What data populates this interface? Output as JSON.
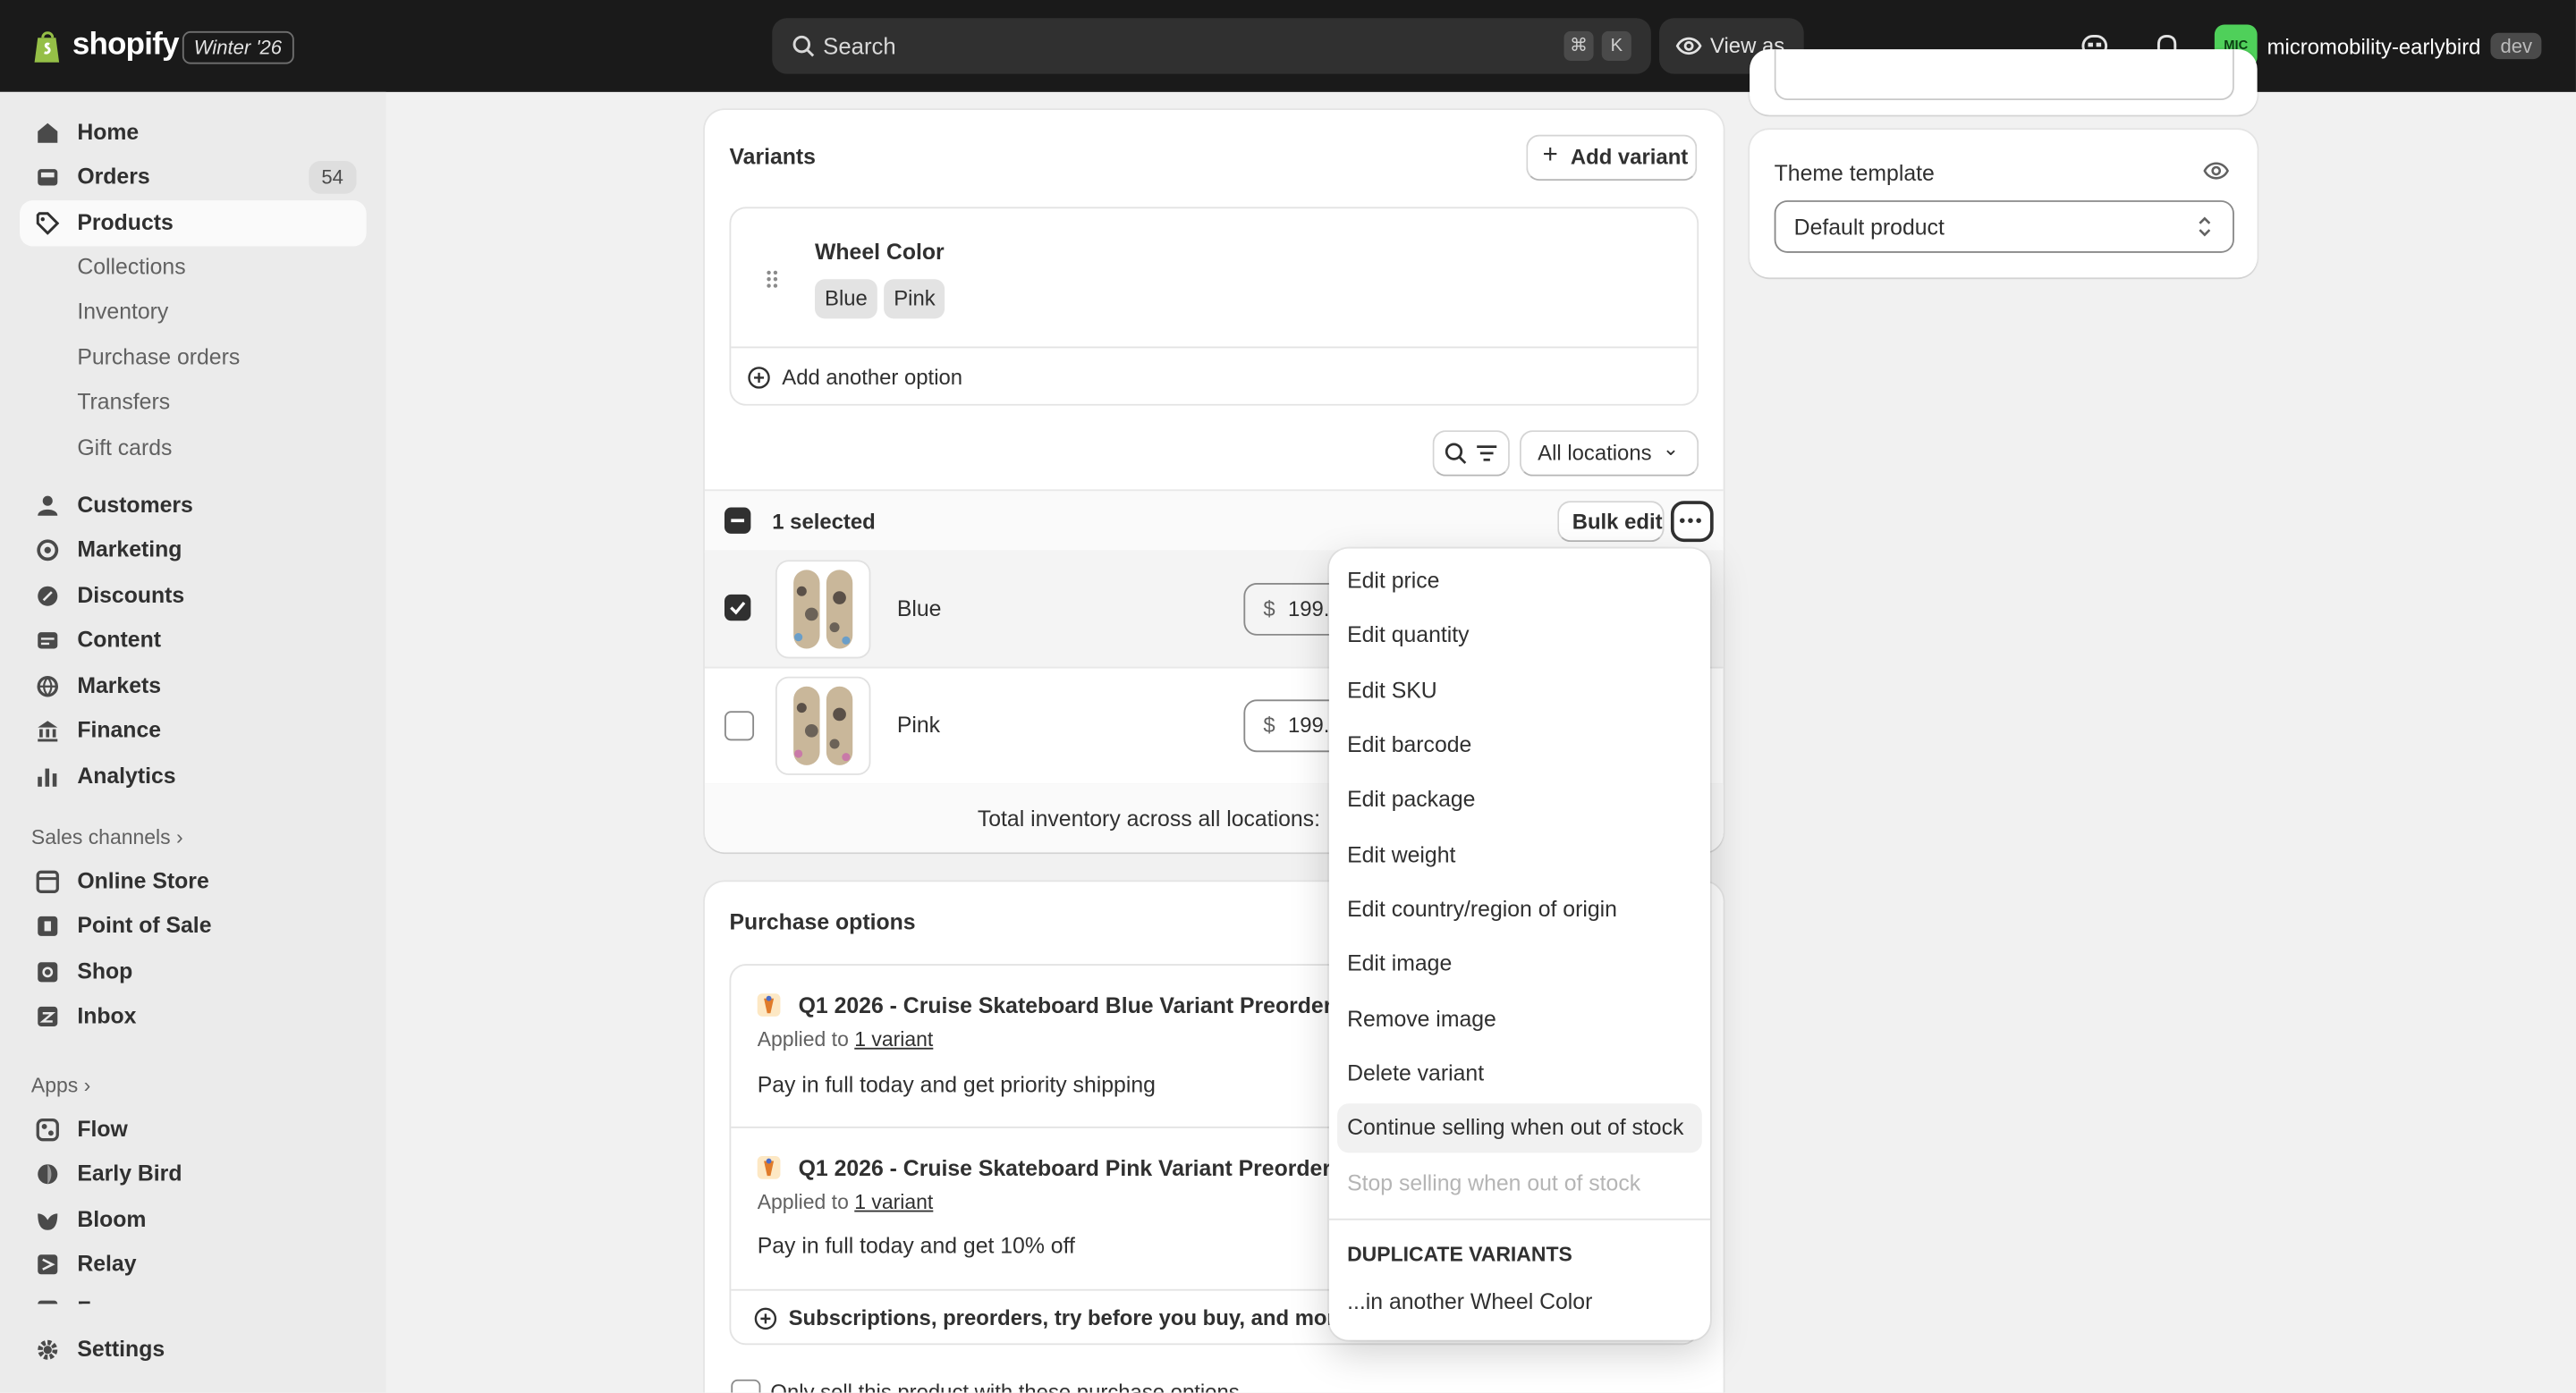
{
  "topbar": {
    "logo_text": "shopify",
    "edition": "Winter '26",
    "search_placeholder": "Search",
    "shortcut_cmd": "⌘",
    "shortcut_key": "K",
    "view_as": "View as",
    "store_initials": "MIC",
    "store_name": "micromobility-earlybird",
    "store_badge": "dev"
  },
  "sidebar": {
    "main": [
      {
        "label": "Home",
        "icon": "home-icon"
      },
      {
        "label": "Orders",
        "icon": "orders-icon",
        "count": "54"
      },
      {
        "label": "Products",
        "icon": "tag-icon",
        "active": true
      }
    ],
    "products_sub": [
      "Collections",
      "Inventory",
      "Purchase orders",
      "Transfers",
      "Gift cards"
    ],
    "more": [
      {
        "label": "Customers",
        "icon": "person-icon"
      },
      {
        "label": "Marketing",
        "icon": "target-icon"
      },
      {
        "label": "Discounts",
        "icon": "discount-icon"
      },
      {
        "label": "Content",
        "icon": "content-icon"
      },
      {
        "label": "Markets",
        "icon": "globe-icon"
      },
      {
        "label": "Finance",
        "icon": "bank-icon"
      },
      {
        "label": "Analytics",
        "icon": "bar-chart-icon"
      }
    ],
    "sales_channels_label": "Sales channels",
    "sales_channels": [
      {
        "label": "Online Store",
        "icon": "store-icon"
      },
      {
        "label": "Point of Sale",
        "icon": "pos-icon"
      },
      {
        "label": "Shop",
        "icon": "shop-icon"
      },
      {
        "label": "Inbox",
        "icon": "inbox-icon"
      }
    ],
    "apps_label": "Apps",
    "apps": [
      {
        "label": "Flow",
        "icon": "flow-icon"
      },
      {
        "label": "Early Bird",
        "icon": "bird-icon"
      },
      {
        "label": "Bloom",
        "icon": "bloom-icon"
      },
      {
        "label": "Relay",
        "icon": "relay-icon"
      },
      {
        "label": "Forms",
        "icon": "forms-icon"
      }
    ],
    "settings": "Settings"
  },
  "variants_card": {
    "title": "Variants",
    "add_variant": "Add variant",
    "option_name": "Wheel Color",
    "option_values": [
      "Blue",
      "Pink"
    ],
    "add_another_option": "Add another option",
    "locations_filter": "All locations",
    "selected_text": "1 selected",
    "bulk_edit": "Bulk edit",
    "rows": [
      {
        "name": "Blue",
        "currency": "$",
        "price": "199.00",
        "checked": true
      },
      {
        "name": "Pink",
        "currency": "$",
        "price": "199.00",
        "checked": false
      }
    ],
    "total_inventory_label": "Total inventory across all locations:"
  },
  "purchase_card": {
    "title": "Purchase options",
    "plans": [
      {
        "title": "Q1 2026 - Cruise Skateboard Blue Variant Preorders",
        "applied_prefix": "Applied to",
        "applied_link": "1 variant",
        "desc": "Pay in full today and get priority shipping"
      },
      {
        "title": "Q1 2026 - Cruise Skateboard Pink Variant Preorders",
        "applied_prefix": "Applied to",
        "applied_link": "1 variant",
        "desc": "Pay in full today and get 10% off"
      }
    ],
    "add_options": "Subscriptions, preorders, try before you buy, and more",
    "only_sell_label": "Only sell this product with these purchase options"
  },
  "theme_card": {
    "title": "Theme template",
    "selected": "Default product"
  },
  "dropdown_menu": {
    "items": [
      "Edit price",
      "Edit quantity",
      "Edit SKU",
      "Edit barcode",
      "Edit package",
      "Edit weight",
      "Edit country/region of origin",
      "Edit image",
      "Remove image",
      "Delete variant",
      "Continue selling when out of stock",
      "Stop selling when out of stock"
    ],
    "highlighted": "Continue selling when out of stock",
    "disabled": "Stop selling when out of stock",
    "section_header": "DUPLICATE VARIANTS",
    "duplicate_item": "...in another Wheel Color"
  },
  "colors": {
    "topbar_bg": "#1a1a1a",
    "page_bg": "#f1f1f1",
    "sidebar_bg": "#ebebeb",
    "store_avatar": "#4fd05a",
    "checkbox_checked": "#303030"
  }
}
